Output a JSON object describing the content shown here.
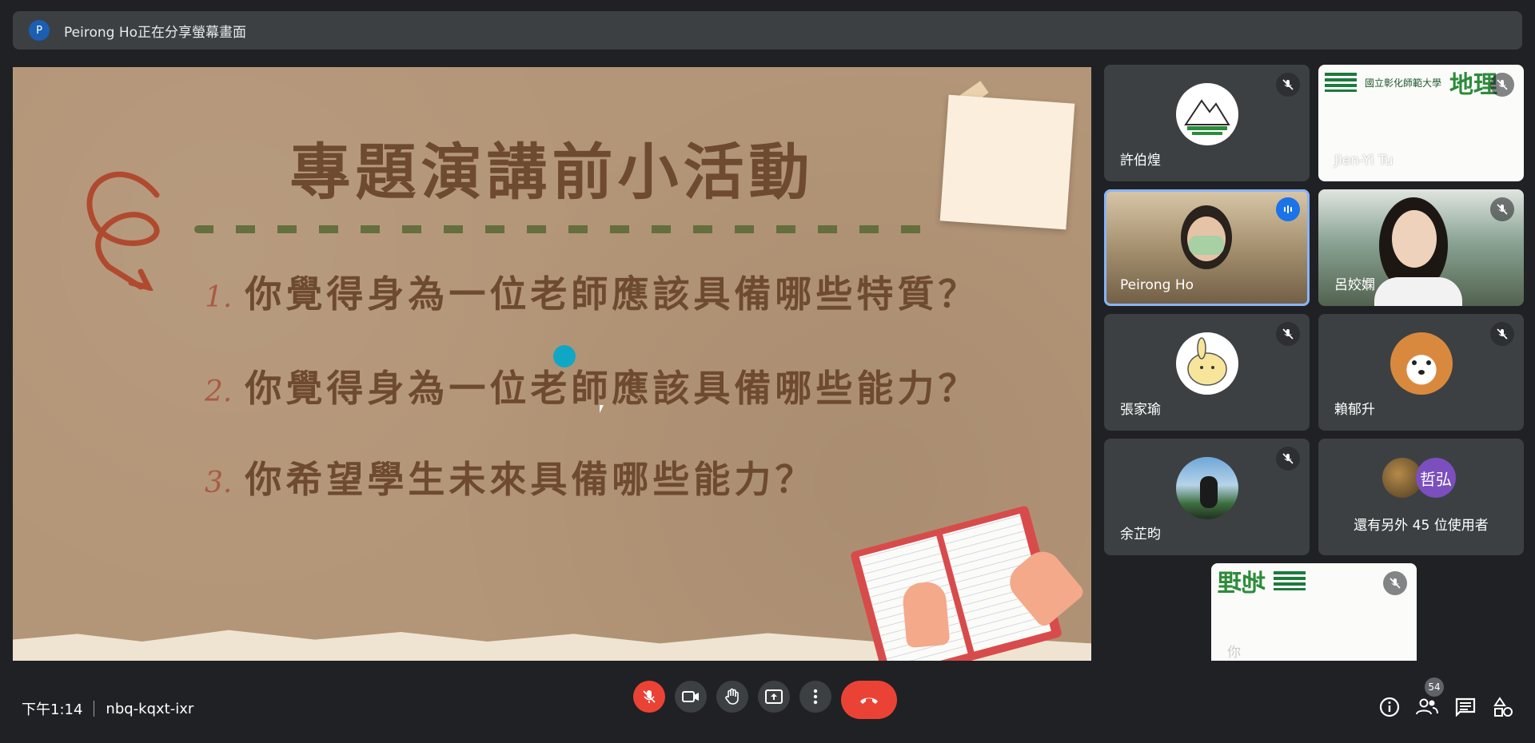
{
  "banner": {
    "avatar_letter": "P",
    "text": "Peirong Ho正在分享螢幕畫面"
  },
  "slide": {
    "title": "專題演講前小活動",
    "questions": [
      {
        "num": "1.",
        "text": "你覺得身為一位老師應該具備哪些特質？"
      },
      {
        "num": "2.",
        "text": "你覺得身為一位老師應該具備哪些能力？"
      },
      {
        "num": "3.",
        "text": "你希望學生未來具備哪些能力？"
      }
    ]
  },
  "participants": [
    {
      "name": "許伯煌",
      "muted": true
    },
    {
      "name": "Jien-Yi Tu",
      "muted": true
    },
    {
      "name": "Peirong Ho",
      "muted": false,
      "speaking": true
    },
    {
      "name": "呂姣嫻",
      "muted": true
    },
    {
      "name": "張家瑜",
      "muted": true
    },
    {
      "name": "賴郁升",
      "muted": true
    },
    {
      "name": "余芷昀",
      "muted": true
    },
    {
      "more_avatar_initial": "哲弘",
      "more_label": "還有另外 45 位使用者"
    },
    {
      "name": "你",
      "muted": true
    }
  ],
  "share_tile": {
    "school_text": "國立彰化師範大學",
    "dept_text": "地理"
  },
  "bottom_bar": {
    "time": "下午1:14",
    "meeting_code": "nbq-kqxt-ixr",
    "participant_count": "54"
  },
  "colors": {
    "background": "#202124",
    "tile": "#3c4043",
    "red": "#ea4335",
    "speaking_outline": "#8ab4f8",
    "slide_bg": "#b39577",
    "slide_text": "#6e4a30"
  },
  "icons": [
    "mic-off-icon",
    "camera-icon",
    "raise-hand-icon",
    "present-icon",
    "more-options-icon",
    "hangup-icon",
    "info-icon",
    "people-icon",
    "chat-icon",
    "activities-icon",
    "speaking-icon"
  ]
}
